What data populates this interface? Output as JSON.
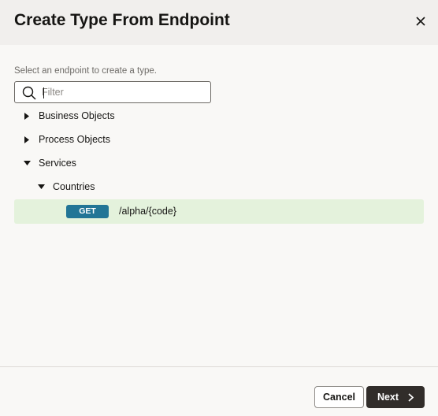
{
  "dialog": {
    "title": "Create Type From Endpoint",
    "close_icon": "close-icon"
  },
  "instruction": "Select an endpoint to create a type.",
  "filter": {
    "placeholder": "Filter",
    "value": "",
    "icon": "search-icon"
  },
  "tree": {
    "items": [
      {
        "label": "Business Objects",
        "expanded": false,
        "level": 0
      },
      {
        "label": "Process Objects",
        "expanded": false,
        "level": 0
      },
      {
        "label": "Services",
        "expanded": true,
        "level": 0
      },
      {
        "label": "Countries",
        "expanded": true,
        "level": 1
      }
    ],
    "endpoint": {
      "method": "GET",
      "path": "/alpha/{code}",
      "selected": true
    }
  },
  "colors": {
    "header_bg": "#f1efed",
    "body_bg": "#f9f8f6",
    "selected_row_bg": "#e4f2dc",
    "method_badge_bg": "#227596",
    "primary_button_bg": "#312d2a"
  },
  "footer": {
    "cancel_label": "Cancel",
    "next_label": "Next",
    "next_icon": "chevron-right-icon"
  }
}
